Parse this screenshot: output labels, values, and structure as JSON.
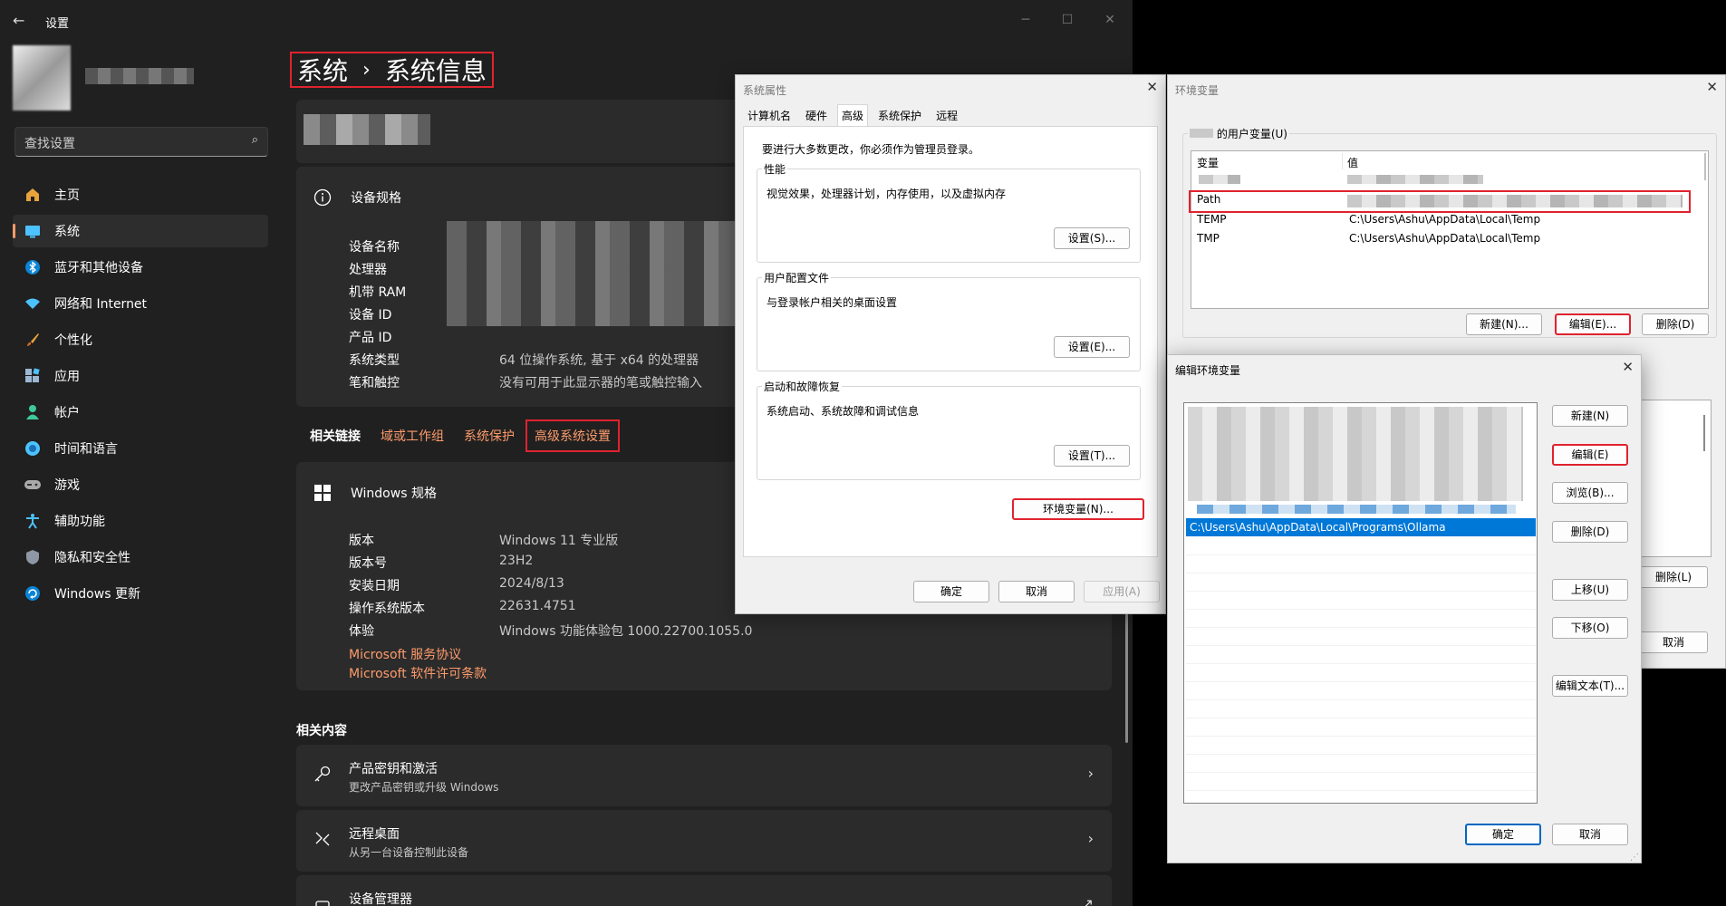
{
  "settings": {
    "app_title": "设置",
    "search_placeholder": "查找设置",
    "nav": [
      {
        "label": "主页",
        "icon": "home-icon"
      },
      {
        "label": "系统",
        "icon": "system-icon"
      },
      {
        "label": "蓝牙和其他设备",
        "icon": "bluetooth-icon"
      },
      {
        "label": "网络和 Internet",
        "icon": "wifi-icon"
      },
      {
        "label": "个性化",
        "icon": "brush-icon"
      },
      {
        "label": "应用",
        "icon": "apps-icon"
      },
      {
        "label": "帐户",
        "icon": "account-icon"
      },
      {
        "label": "时间和语言",
        "icon": "globe-icon"
      },
      {
        "label": "游戏",
        "icon": "gamepad-icon"
      },
      {
        "label": "辅助功能",
        "icon": "accessibility-icon"
      },
      {
        "label": "隐私和安全性",
        "icon": "shield-icon"
      },
      {
        "label": "Windows 更新",
        "icon": "update-icon"
      }
    ],
    "breadcrumb": {
      "parent": "系统",
      "current": "系统信息"
    },
    "device_specs": {
      "title": "设备规格",
      "rows": [
        {
          "label": "设备名称",
          "value": ""
        },
        {
          "label": "处理器",
          "value": ""
        },
        {
          "label": "机带 RAM",
          "value": ""
        },
        {
          "label": "设备 ID",
          "value": ""
        },
        {
          "label": "产品 ID",
          "value": ""
        },
        {
          "label": "系统类型",
          "value": "64 位操作系统, 基于 x64 的处理器"
        },
        {
          "label": "笔和触控",
          "value": "没有可用于此显示器的笔或触控输入"
        }
      ]
    },
    "related_links": {
      "title": "相关链接",
      "links": [
        "域或工作组",
        "系统保护",
        "高级系统设置"
      ]
    },
    "windows_specs": {
      "title": "Windows 规格",
      "rows": [
        {
          "label": "版本",
          "value": "Windows 11 专业版"
        },
        {
          "label": "版本号",
          "value": "23H2"
        },
        {
          "label": "安装日期",
          "value": "2024/8/13"
        },
        {
          "label": "操作系统版本",
          "value": "22631.4751"
        },
        {
          "label": "体验",
          "value": "Windows 功能体验包 1000.22700.1055.0"
        }
      ],
      "links": [
        "Microsoft 服务协议",
        "Microsoft 软件许可条款"
      ]
    },
    "related_content": {
      "title": "相关内容",
      "items": [
        {
          "title": "产品密钥和激活",
          "subtitle": "更改产品密钥或升级 Windows"
        },
        {
          "title": "远程桌面",
          "subtitle": "从另一台设备控制此设备"
        },
        {
          "title": "设备管理器",
          "subtitle": ""
        }
      ]
    }
  },
  "sysprops": {
    "title": "系统属性",
    "tabs": [
      "计算机名",
      "硬件",
      "高级",
      "系统保护",
      "远程"
    ],
    "active_tab": "高级",
    "admin_note": "要进行大多数更改，你必须作为管理员登录。",
    "groups": [
      {
        "label": "性能",
        "desc": "视觉效果，处理器计划，内存使用，以及虚拟内存",
        "button": "设置(S)..."
      },
      {
        "label": "用户配置文件",
        "desc": "与登录帐户相关的桌面设置",
        "button": "设置(E)..."
      },
      {
        "label": "启动和故障恢复",
        "desc": "系统启动、系统故障和调试信息",
        "button": "设置(T)..."
      }
    ],
    "env_button": "环境变量(N)...",
    "ok": "确定",
    "cancel": "取消",
    "apply": "应用(A)"
  },
  "envvars": {
    "title": "环境变量",
    "user_vars_label": "的用户变量(U)",
    "columns": [
      "变量",
      "值"
    ],
    "rows": [
      {
        "name": "",
        "value": ""
      },
      {
        "name": "Path",
        "value": ""
      },
      {
        "name": "TEMP",
        "value": "C:\\Users\\Ashu\\AppData\\Local\\Temp"
      },
      {
        "name": "TMP",
        "value": "C:\\Users\\Ashu\\AppData\\Local\\Temp"
      }
    ],
    "new_button": "新建(N)...",
    "edit_button": "编辑(E)...",
    "delete_button": "删除(D)",
    "sys_delete_button": "删除(L)",
    "cancel": "取消"
  },
  "editenv": {
    "title": "编辑环境变量",
    "selected_entry": "C:\\Users\\Ashu\\AppData\\Local\\Programs\\Ollama",
    "buttons": {
      "new": "新建(N)",
      "edit": "编辑(E)",
      "browse": "浏览(B)...",
      "delete": "删除(D)",
      "up": "上移(U)",
      "down": "下移(O)",
      "edit_text": "编辑文本(T)..."
    },
    "ok": "确定",
    "cancel": "取消"
  },
  "colors": {
    "accent": "#fd9b6b",
    "highlight_box": "#e0232e",
    "selection": "#0078d7",
    "dark_bg": "#202020",
    "card_bg": "#2b2b2b"
  }
}
